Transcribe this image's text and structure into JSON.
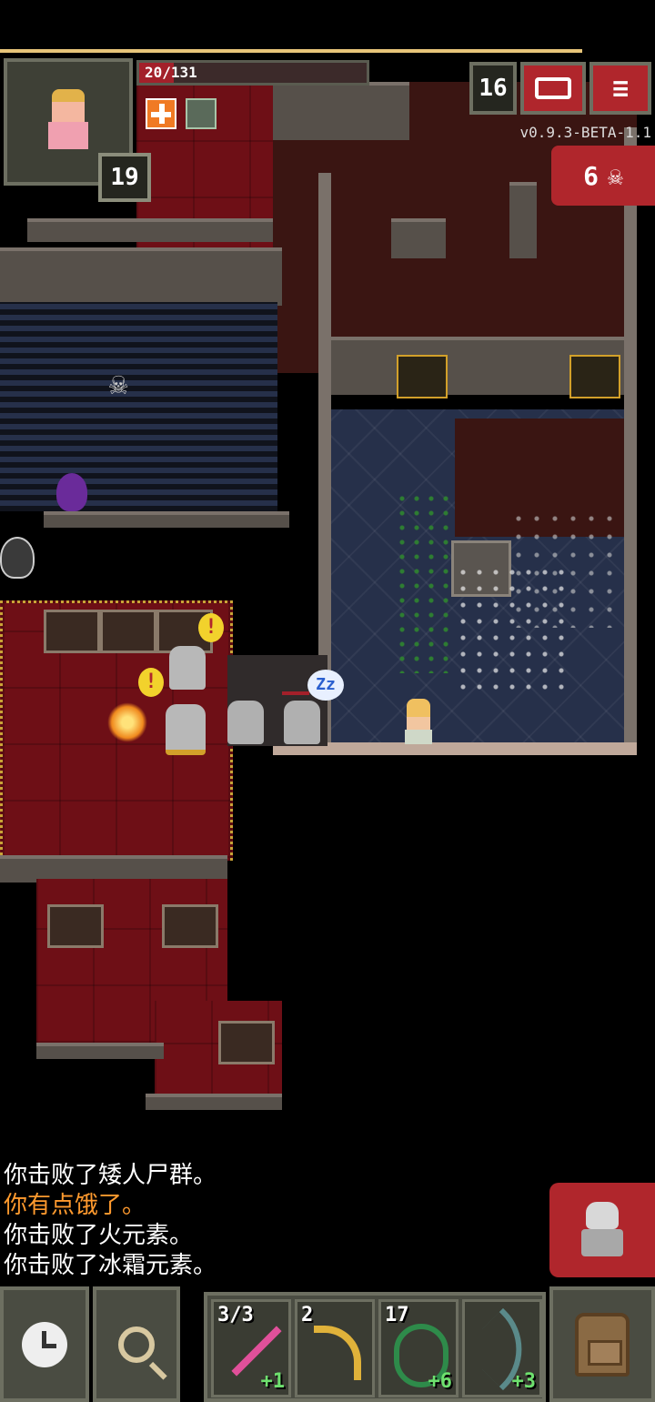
{
  "hud": {
    "hp_text": "20/131",
    "hp_fraction": 0.153,
    "hero_level": "19",
    "depth": "16",
    "version": "v0.9.3-BETA-1.1",
    "danger_count": "6",
    "buffs": [
      "hunger-buff-icon",
      "shielding-buff-icon"
    ]
  },
  "buttons": {
    "journal_icon": "journal-icon",
    "menu_icon": "menu-icon",
    "wait_icon": "clock-icon",
    "search_icon": "magnifier-icon",
    "backpack_icon": "backpack-icon",
    "attack_target": "skeleton-icon"
  },
  "map": {
    "sleep_bubble": "Zz",
    "alert_mark": "!"
  },
  "log": [
    {
      "text": "你击败了矮人尸群。",
      "color": "#ffffff"
    },
    {
      "text": "你有点饿了。",
      "color": "#ff9a2e"
    },
    {
      "text": "你击败了火元素。",
      "color": "#ffffff"
    },
    {
      "text": "你击败了冰霜元素。",
      "color": "#ffffff"
    }
  ],
  "quickslots": [
    {
      "count": "3/3",
      "bonus": "+1",
      "item": "wand-icon"
    },
    {
      "count": "2",
      "bonus": "",
      "item": "boomerang-icon"
    },
    {
      "count": "17",
      "bonus": "+6",
      "item": "bolas-icon"
    },
    {
      "count": "",
      "bonus": "+3",
      "item": "bow-icon"
    }
  ],
  "colors": {
    "accent_red": "#b0262c",
    "hp_red": "#a3202a",
    "hunger_orange": "#ff9a2e",
    "bonus_green": "#6ee06e"
  }
}
